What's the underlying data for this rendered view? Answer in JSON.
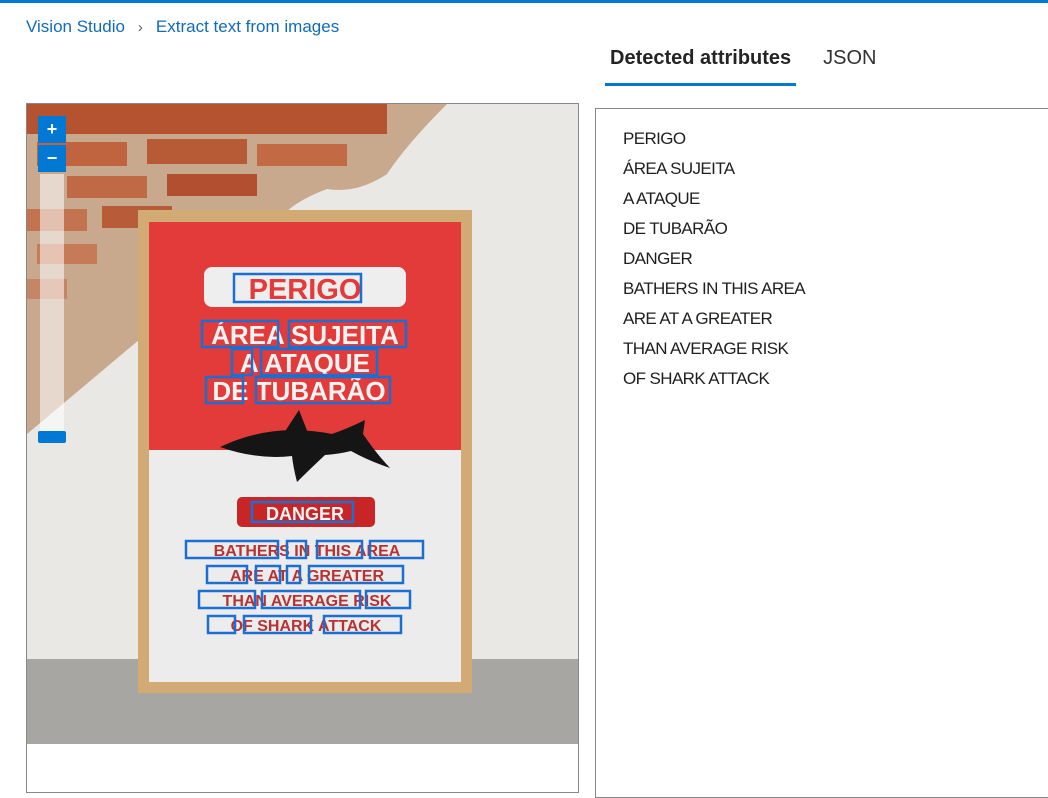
{
  "breadcrumb": {
    "home": "Vision Studio",
    "separator": ">",
    "current": "Extract text from images"
  },
  "tabs": [
    {
      "label": "Detected attributes",
      "active": true
    },
    {
      "label": "JSON",
      "active": false
    }
  ],
  "zoom": {
    "in_label": "+",
    "out_label": "−"
  },
  "detected_lines": [
    "PERIGO",
    "ÁREA SUJEITA",
    "A ATAQUE",
    "DE TUBARÃO",
    "DANGER",
    "BATHERS IN THIS AREA",
    "ARE AT A GREATER",
    "THAN AVERAGE RISK",
    "OF SHARK ATTACK"
  ],
  "colors": {
    "accent": "#0078d4",
    "sign_red": "#e33a3a",
    "text_box": "#1a6fd1"
  }
}
